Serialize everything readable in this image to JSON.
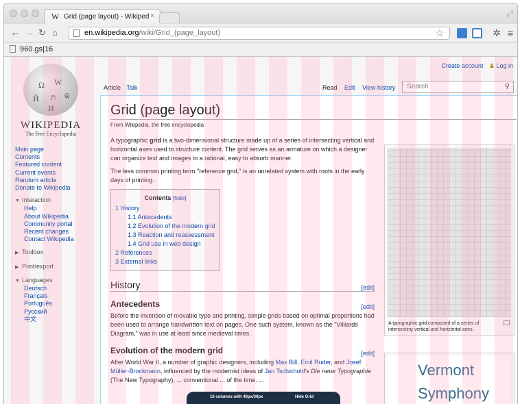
{
  "browser": {
    "tab_title": "Grid (page layout) - Wikiped",
    "tab_close": "×",
    "url_host": "en.wikipedia.org",
    "url_path": "/wiki/Grid_(page_layout)",
    "bookmark": "960.gs|16"
  },
  "page": {
    "top_links": {
      "create_account": "Create account",
      "log_in": "Log in"
    },
    "logo": {
      "wordmark": "WIKIPEDIA",
      "tagline": "The Free Encyclopedia",
      "glyphs": [
        "Ω",
        "W",
        "Й",
        "ת",
        "ѿ",
        "И"
      ]
    },
    "namespace_tabs": {
      "article": "Article",
      "talk": "Talk"
    },
    "view_tabs": {
      "read": "Read",
      "edit": "Edit",
      "history": "View history"
    },
    "search_placeholder": "Search",
    "sidebar": {
      "nav": [
        "Main page",
        "Contents",
        "Featured content",
        "Current events",
        "Random article",
        "Donate to Wikipedia"
      ],
      "interaction_label": "Interaction",
      "interaction": [
        "Help",
        "About Wikipedia",
        "Community portal",
        "Recent changes",
        "Contact Wikipedia"
      ],
      "toolbox": "Toolbox",
      "printexport": "Print/export",
      "languages_label": "Languages",
      "languages": [
        "Deutsch",
        "Français",
        "Português",
        "Русский",
        "中文"
      ]
    },
    "title": "Grid (page layout)",
    "sitesub": "From Wikipedia, the free encyclopedia",
    "intro": {
      "p1_pre": "A typographic ",
      "p1_bold": "grid",
      "p1_post": " is a two-dimensional structure made up of a series of intersecting vertical and horizontal axes used to structure content. The grid serves as an armature on which a designer can organize text and images in a rational, easy to absorb manner.",
      "p2": "The less common printing term \"reference grid,\" is an unrelated system with roots in the early days of printing."
    },
    "toc": {
      "title": "Contents",
      "hide": "[hide]",
      "items": [
        {
          "text": "1 History",
          "level": 1
        },
        {
          "text": "1.1 Antecedents",
          "level": 2
        },
        {
          "text": "1.2 Evolution of the modern grid",
          "level": 2
        },
        {
          "text": "1.3 Reaction and reassessment",
          "level": 2
        },
        {
          "text": "1.4 Grid use in web design",
          "level": 2
        },
        {
          "text": "2 References",
          "level": 1
        },
        {
          "text": "3 External links",
          "level": 1
        }
      ]
    },
    "edit_label": "[edit]",
    "history_heading": "History",
    "antecedents_heading": "Antecedents",
    "antecedents_text": "Before the invention of movable type and printing, simple grids based on optimal proportions had been used to arrange handwritten text on pages. One such system, known as the \"Villiards Diagram,\" was in use at least since medieval times.",
    "evolution_heading": "Evolution of the modern grid",
    "evolution": {
      "t1": "After World War II, a number of graphic designers, including ",
      "l1": "Max Bill",
      "t2": ", ",
      "l2": "Emil Ruder",
      "t3": ", and ",
      "l3": "Josef Müller-Brockmann",
      "t4": ", influenced by the modernist ideas of ",
      "l4": "Jan Tschichold",
      "t5": "'s ",
      "i1": "Die neue Typographie",
      "t6": " (The New Typography), ... conventional ... of the time. ..."
    },
    "figure1_caption": "A typographic grid composed of a series of intersecting vertical and horizontal axes.",
    "figure2_text": "Vermont Symphony"
  },
  "overlay": {
    "grid_info": "16 columns with 40px/30px",
    "hide_grid": "Hide Grid"
  }
}
